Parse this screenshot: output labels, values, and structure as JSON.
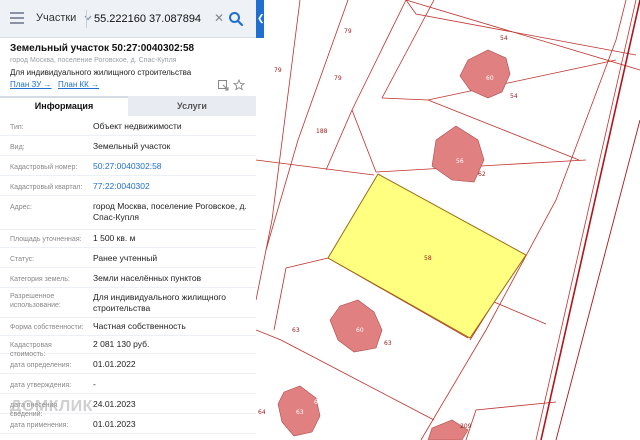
{
  "search": {
    "layer": "Участки",
    "query": "55.222160 37.087894"
  },
  "parcel": {
    "title": "Земельный участок 50:27:0040302:58",
    "address": "город Москва, поселение Роговское, д. Спас-Купля",
    "purpose": "Для индивидуального жилищного строительства",
    "links": [
      "План ЗУ →",
      "План КК →"
    ]
  },
  "tabs": [
    "Информация",
    "Услуги"
  ],
  "rows": [
    {
      "label": "Тип:",
      "value": "Объект недвижимости",
      "link": false
    },
    {
      "label": "Вид:",
      "value": "Земельный участок",
      "link": false
    },
    {
      "label": "Кадастровый номер:",
      "value": "50:27:0040302:58",
      "link": true
    },
    {
      "label": "Кадастровый квартал:",
      "value": "77:22:0040302",
      "link": true
    },
    {
      "label": "Адрес:",
      "value": "город Москва, поселение Роговское, д. Спас-Купля",
      "link": false
    },
    {
      "label": "Площадь уточненная:",
      "value": "1 500 кв. м",
      "link": false
    },
    {
      "label": "Статус:",
      "value": "Ранее учтенный",
      "link": false
    },
    {
      "label": "Категория земель:",
      "value": "Земли населённых пунктов",
      "link": false
    },
    {
      "label": "Разрешенное использование:",
      "value": "Для индивидуального жилищного строительства",
      "link": false
    },
    {
      "label": "Форма собственности:",
      "value": "Частная собственность",
      "link": false
    },
    {
      "label": "Кадастровая стоимость:",
      "value": "2 081 130 руб.",
      "link": false
    },
    {
      "label": "дата определения:",
      "value": "01.01.2022",
      "link": false
    },
    {
      "label": "дата утверждения:",
      "value": "-",
      "link": false
    },
    {
      "label": "дата внесения сведений:",
      "value": "24.01.2023",
      "link": false
    },
    {
      "label": "дата применения:",
      "value": "01.01.2023",
      "link": false
    }
  ],
  "watermark": "ДОМКЛИК",
  "map": {
    "selected_parcel": "58",
    "parcel_labels": [
      "79",
      "79",
      "79",
      "54",
      "54",
      "188",
      "62",
      "63",
      "63",
      "64",
      "209"
    ],
    "building_labels": [
      "60",
      "56",
      "60",
      "63",
      "64"
    ]
  },
  "colors": {
    "accent": "#1f6fd1",
    "selected_fill": "#ffff80",
    "building_fill": "#e08080",
    "boundary": "#c0302a"
  }
}
